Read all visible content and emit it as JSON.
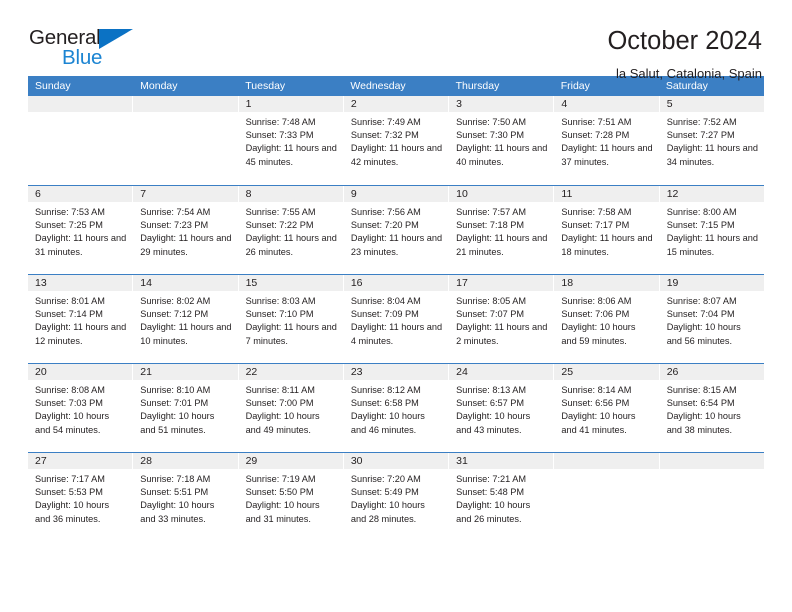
{
  "brand": {
    "word1": "General",
    "word2": "Blue",
    "triangle_color": "#0b72c4",
    "word1_color": "#231f20",
    "word2_color": "#1b84d2"
  },
  "header": {
    "title": "October 2024",
    "subtitle": "la Salut, Catalonia, Spain"
  },
  "theme": {
    "header_bar": "#3b7fc4",
    "daynum_band": "#efefef",
    "week_divider": "#3b7fc4",
    "text": "#231f20"
  },
  "calendar": {
    "weekday_headers": [
      "Sunday",
      "Monday",
      "Tuesday",
      "Wednesday",
      "Thursday",
      "Friday",
      "Saturday"
    ],
    "weeks": [
      [
        {
          "day": "",
          "sunrise": "",
          "sunset": "",
          "daylight": ""
        },
        {
          "day": "",
          "sunrise": "",
          "sunset": "",
          "daylight": ""
        },
        {
          "day": "1",
          "sunrise": "Sunrise: 7:48 AM",
          "sunset": "Sunset: 7:33 PM",
          "daylight": "Daylight: 11 hours and 45 minutes."
        },
        {
          "day": "2",
          "sunrise": "Sunrise: 7:49 AM",
          "sunset": "Sunset: 7:32 PM",
          "daylight": "Daylight: 11 hours and 42 minutes."
        },
        {
          "day": "3",
          "sunrise": "Sunrise: 7:50 AM",
          "sunset": "Sunset: 7:30 PM",
          "daylight": "Daylight: 11 hours and 40 minutes."
        },
        {
          "day": "4",
          "sunrise": "Sunrise: 7:51 AM",
          "sunset": "Sunset: 7:28 PM",
          "daylight": "Daylight: 11 hours and 37 minutes."
        },
        {
          "day": "5",
          "sunrise": "Sunrise: 7:52 AM",
          "sunset": "Sunset: 7:27 PM",
          "daylight": "Daylight: 11 hours and 34 minutes."
        }
      ],
      [
        {
          "day": "6",
          "sunrise": "Sunrise: 7:53 AM",
          "sunset": "Sunset: 7:25 PM",
          "daylight": "Daylight: 11 hours and 31 minutes."
        },
        {
          "day": "7",
          "sunrise": "Sunrise: 7:54 AM",
          "sunset": "Sunset: 7:23 PM",
          "daylight": "Daylight: 11 hours and 29 minutes."
        },
        {
          "day": "8",
          "sunrise": "Sunrise: 7:55 AM",
          "sunset": "Sunset: 7:22 PM",
          "daylight": "Daylight: 11 hours and 26 minutes."
        },
        {
          "day": "9",
          "sunrise": "Sunrise: 7:56 AM",
          "sunset": "Sunset: 7:20 PM",
          "daylight": "Daylight: 11 hours and 23 minutes."
        },
        {
          "day": "10",
          "sunrise": "Sunrise: 7:57 AM",
          "sunset": "Sunset: 7:18 PM",
          "daylight": "Daylight: 11 hours and 21 minutes."
        },
        {
          "day": "11",
          "sunrise": "Sunrise: 7:58 AM",
          "sunset": "Sunset: 7:17 PM",
          "daylight": "Daylight: 11 hours and 18 minutes."
        },
        {
          "day": "12",
          "sunrise": "Sunrise: 8:00 AM",
          "sunset": "Sunset: 7:15 PM",
          "daylight": "Daylight: 11 hours and 15 minutes."
        }
      ],
      [
        {
          "day": "13",
          "sunrise": "Sunrise: 8:01 AM",
          "sunset": "Sunset: 7:14 PM",
          "daylight": "Daylight: 11 hours and 12 minutes."
        },
        {
          "day": "14",
          "sunrise": "Sunrise: 8:02 AM",
          "sunset": "Sunset: 7:12 PM",
          "daylight": "Daylight: 11 hours and 10 minutes."
        },
        {
          "day": "15",
          "sunrise": "Sunrise: 8:03 AM",
          "sunset": "Sunset: 7:10 PM",
          "daylight": "Daylight: 11 hours and 7 minutes."
        },
        {
          "day": "16",
          "sunrise": "Sunrise: 8:04 AM",
          "sunset": "Sunset: 7:09 PM",
          "daylight": "Daylight: 11 hours and 4 minutes."
        },
        {
          "day": "17",
          "sunrise": "Sunrise: 8:05 AM",
          "sunset": "Sunset: 7:07 PM",
          "daylight": "Daylight: 11 hours and 2 minutes."
        },
        {
          "day": "18",
          "sunrise": "Sunrise: 8:06 AM",
          "sunset": "Sunset: 7:06 PM",
          "daylight": "Daylight: 10 hours and 59 minutes."
        },
        {
          "day": "19",
          "sunrise": "Sunrise: 8:07 AM",
          "sunset": "Sunset: 7:04 PM",
          "daylight": "Daylight: 10 hours and 56 minutes."
        }
      ],
      [
        {
          "day": "20",
          "sunrise": "Sunrise: 8:08 AM",
          "sunset": "Sunset: 7:03 PM",
          "daylight": "Daylight: 10 hours and 54 minutes."
        },
        {
          "day": "21",
          "sunrise": "Sunrise: 8:10 AM",
          "sunset": "Sunset: 7:01 PM",
          "daylight": "Daylight: 10 hours and 51 minutes."
        },
        {
          "day": "22",
          "sunrise": "Sunrise: 8:11 AM",
          "sunset": "Sunset: 7:00 PM",
          "daylight": "Daylight: 10 hours and 49 minutes."
        },
        {
          "day": "23",
          "sunrise": "Sunrise: 8:12 AM",
          "sunset": "Sunset: 6:58 PM",
          "daylight": "Daylight: 10 hours and 46 minutes."
        },
        {
          "day": "24",
          "sunrise": "Sunrise: 8:13 AM",
          "sunset": "Sunset: 6:57 PM",
          "daylight": "Daylight: 10 hours and 43 minutes."
        },
        {
          "day": "25",
          "sunrise": "Sunrise: 8:14 AM",
          "sunset": "Sunset: 6:56 PM",
          "daylight": "Daylight: 10 hours and 41 minutes."
        },
        {
          "day": "26",
          "sunrise": "Sunrise: 8:15 AM",
          "sunset": "Sunset: 6:54 PM",
          "daylight": "Daylight: 10 hours and 38 minutes."
        }
      ],
      [
        {
          "day": "27",
          "sunrise": "Sunrise: 7:17 AM",
          "sunset": "Sunset: 5:53 PM",
          "daylight": "Daylight: 10 hours and 36 minutes."
        },
        {
          "day": "28",
          "sunrise": "Sunrise: 7:18 AM",
          "sunset": "Sunset: 5:51 PM",
          "daylight": "Daylight: 10 hours and 33 minutes."
        },
        {
          "day": "29",
          "sunrise": "Sunrise: 7:19 AM",
          "sunset": "Sunset: 5:50 PM",
          "daylight": "Daylight: 10 hours and 31 minutes."
        },
        {
          "day": "30",
          "sunrise": "Sunrise: 7:20 AM",
          "sunset": "Sunset: 5:49 PM",
          "daylight": "Daylight: 10 hours and 28 minutes."
        },
        {
          "day": "31",
          "sunrise": "Sunrise: 7:21 AM",
          "sunset": "Sunset: 5:48 PM",
          "daylight": "Daylight: 10 hours and 26 minutes."
        },
        {
          "day": "",
          "sunrise": "",
          "sunset": "",
          "daylight": ""
        },
        {
          "day": "",
          "sunrise": "",
          "sunset": "",
          "daylight": ""
        }
      ]
    ]
  }
}
